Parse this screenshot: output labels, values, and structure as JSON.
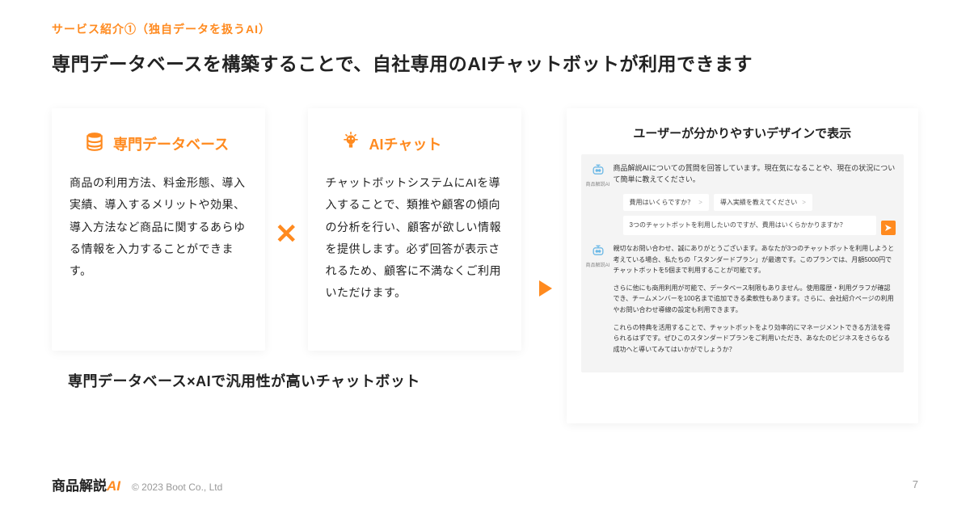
{
  "eyebrow": "サービス紹介①（独自データを扱うAI）",
  "headline": "専門データベースを構築することで、自社専用のAIチャットボットが利用できます",
  "card1": {
    "title": "専門データベース",
    "body": "商品の利用方法、料金形態、導入実績、導入するメリットや効果、導入方法など商品に関するあらゆる情報を入力することができます。"
  },
  "card2": {
    "title": "AIチャット",
    "body": "チャットボットシステムにAIを導入することで、類推や顧客の傾向の分析を行い、顧客が欲しい情報を提供します。必ず回答が表示されるため、顧客に不満なくご利用いただけます。"
  },
  "times": "✕",
  "caption": "専門データベース×AIで汎用性が高いチャットボット",
  "panel": {
    "title": "ユーザーが分かりやすいデザインで表示",
    "avatar_label": "商品解説AI",
    "bot_intro": "商品解説AIについての質問を回答しています。現在気になることや、現在の状況について簡単に教えてください。",
    "chip1": "費用はいくらですか？",
    "chip2": "導入実績を教えてください",
    "user_msg": "3つのチャットボットを利用したいのですが、費用はいくらかかりますか？",
    "reply1": "親切なお問い合わせ、誠にありがとうございます。あなたが3つのチャットボットを利用しようと考えている場合、私たちの「スタンダードプラン」が最適です。このプランでは、月額5000円でチャットボットを5個まで利用することが可能です。",
    "reply2": "さらに他にも商用利用が可能で、データベース制限もありません。使用履歴・利用グラフが確認でき、チームメンバーを100名まで追加できる柔軟性もあります。さらに、会社紹介ページの利用やお問い合わせ導線の設定も利用できます。",
    "reply3": "これらの特典を活用することで、チャットボットをより効率的にマネージメントできる方法を得られるはずです。ぜひこのスタンダードプランをご利用いただき、あなたのビジネスをさらなる成功へと導いてみてはいかがでしょうか？"
  },
  "footer": {
    "logo": "商品解説",
    "logo_suffix": "AI",
    "copyright": "© 2023 Boot Co., Ltd",
    "page": "7"
  }
}
